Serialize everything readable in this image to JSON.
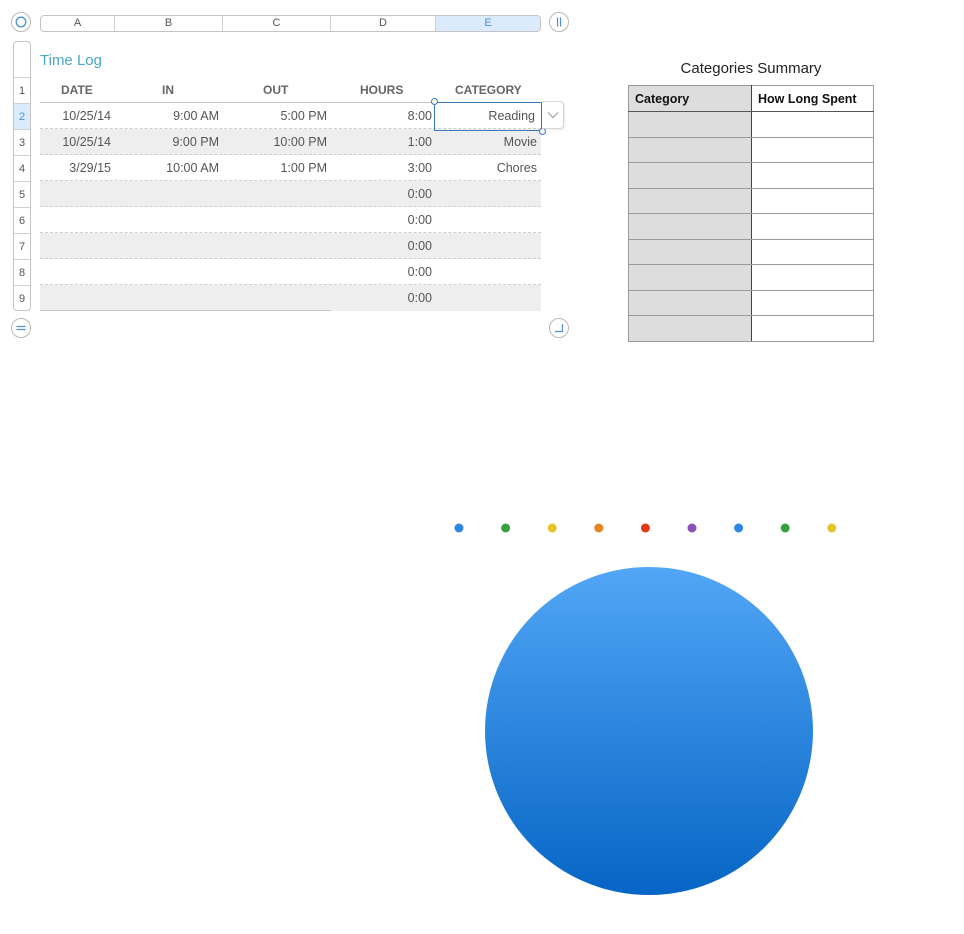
{
  "spreadsheet": {
    "column_headers": [
      {
        "label": "A",
        "selected": false
      },
      {
        "label": "B",
        "selected": false
      },
      {
        "label": "C",
        "selected": false
      },
      {
        "label": "D",
        "selected": false
      },
      {
        "label": "E",
        "selected": true
      }
    ],
    "row_headers": [
      {
        "label": "1",
        "selected": false
      },
      {
        "label": "2",
        "selected": true
      },
      {
        "label": "3",
        "selected": false
      },
      {
        "label": "4",
        "selected": false
      },
      {
        "label": "5",
        "selected": false
      },
      {
        "label": "6",
        "selected": false
      },
      {
        "label": "7",
        "selected": false
      },
      {
        "label": "8",
        "selected": false
      },
      {
        "label": "9",
        "selected": false
      }
    ]
  },
  "time_log": {
    "title": "Time Log",
    "headers": [
      "DATE",
      "IN",
      "OUT",
      "HOURS",
      "CATEGORY"
    ],
    "rows": [
      {
        "date": "10/25/14",
        "in": "9:00 AM",
        "out": "5:00 PM",
        "hours": "8:00",
        "category": "Reading"
      },
      {
        "date": "10/25/14",
        "in": "9:00 PM",
        "out": "10:00 PM",
        "hours": "1:00",
        "category": "Movie"
      },
      {
        "date": "3/29/15",
        "in": "10:00 AM",
        "out": "1:00 PM",
        "hours": "3:00",
        "category": "Chores"
      },
      {
        "date": "",
        "in": "",
        "out": "",
        "hours": "0:00",
        "category": ""
      },
      {
        "date": "",
        "in": "",
        "out": "",
        "hours": "0:00",
        "category": ""
      },
      {
        "date": "",
        "in": "",
        "out": "",
        "hours": "0:00",
        "category": ""
      },
      {
        "date": "",
        "in": "",
        "out": "",
        "hours": "0:00",
        "category": ""
      },
      {
        "date": "",
        "in": "",
        "out": "",
        "hours": "0:00",
        "category": ""
      }
    ],
    "selected_cell": "E2"
  },
  "summary": {
    "title": "Categories Summary",
    "headers": [
      "Category",
      "How Long Spent"
    ],
    "rows": [
      [
        "",
        ""
      ],
      [
        "",
        ""
      ],
      [
        "",
        ""
      ],
      [
        "",
        ""
      ],
      [
        "",
        ""
      ],
      [
        "",
        ""
      ],
      [
        "",
        ""
      ],
      [
        "",
        ""
      ],
      [
        "",
        ""
      ]
    ]
  },
  "icons": {
    "select_table": "circle-icon",
    "add_column": "pause-bars-icon",
    "add_row": "equals-icon",
    "resize": "corner-resize-icon",
    "dropdown": "chevron-down-icon"
  },
  "chart_data": {
    "type": "pie",
    "title": "",
    "categories": [
      "",
      "",
      "",
      "",
      "",
      "",
      "",
      "",
      ""
    ],
    "values": [
      1,
      0,
      0,
      0,
      0,
      0,
      0,
      0,
      0
    ],
    "legend_colors": [
      "#2f86e0",
      "#36a23c",
      "#e3c42a",
      "#e98223",
      "#e03a14",
      "#8a52b4",
      "#2f86e0",
      "#36a23c",
      "#e3c42a"
    ],
    "slice_gradient": [
      "#52a6f6",
      "#0665c5"
    ],
    "legend_placement": "top"
  }
}
